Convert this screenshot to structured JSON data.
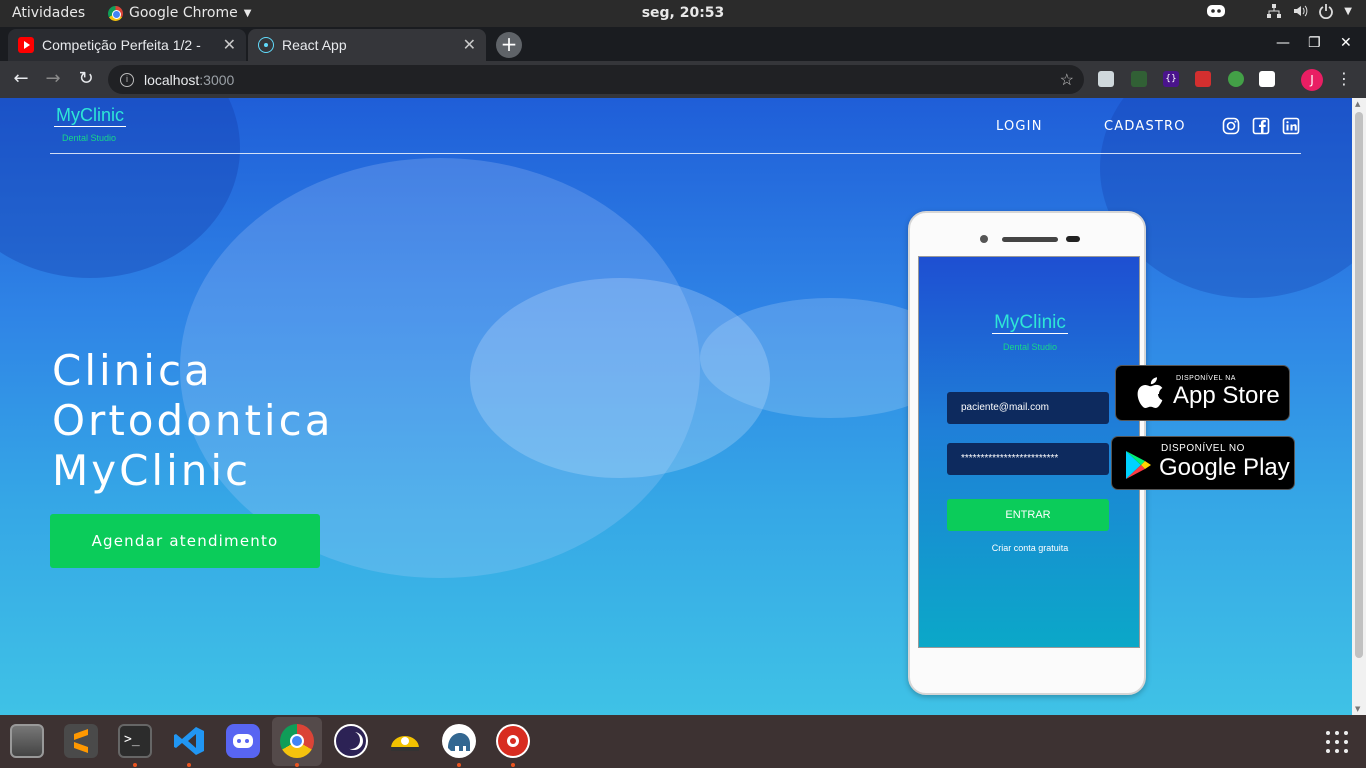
{
  "topbar": {
    "activities": "Atividades",
    "app_name": "Google Chrome",
    "clock": "seg, 20:53"
  },
  "tabs": [
    {
      "label": "Competição Perfeita 1/2 -",
      "icon": "youtube-icon"
    },
    {
      "label": "React App",
      "icon": "react-icon"
    }
  ],
  "address_bar": {
    "host": "localhost",
    "port": ":3000"
  },
  "profile": {
    "initial": "J",
    "color": "#e91e63"
  },
  "site": {
    "logo": {
      "title": "MyClinic",
      "subtitle": "Dental Studio"
    },
    "nav": {
      "login": "LOGIN",
      "signup": "CADASTRO"
    },
    "social": [
      "instagram-icon",
      "facebook-icon",
      "linkedin-icon"
    ],
    "hero": {
      "line1": "Clinica",
      "line2": "Ortodontica",
      "line3": "MyClinic",
      "cta": "Agendar atendimento"
    },
    "phone": {
      "logo_title": "MyClinic",
      "logo_subtitle": "Dental Studio",
      "email_value": "paciente@mail.com",
      "password_value": "*************************",
      "submit": "ENTRAR",
      "signup_link": "Criar conta gratuita"
    },
    "badges": {
      "appstore_small": "DISPONÍVEL NA",
      "appstore_big": "App Store",
      "play_small": "DISPONÍVEL NO",
      "play_big": "Google Play"
    },
    "colors": {
      "accent_green": "#0bcc5a",
      "logo_cyan": "#2ee6d6"
    }
  },
  "dock": [
    "files-icon",
    "sublime-text-icon",
    "terminal-icon",
    "vscode-icon",
    "discord-icon",
    "chrome-icon",
    "eclipse-icon",
    "insomnia-icon",
    "pgadmin-icon",
    "redis-icon"
  ]
}
